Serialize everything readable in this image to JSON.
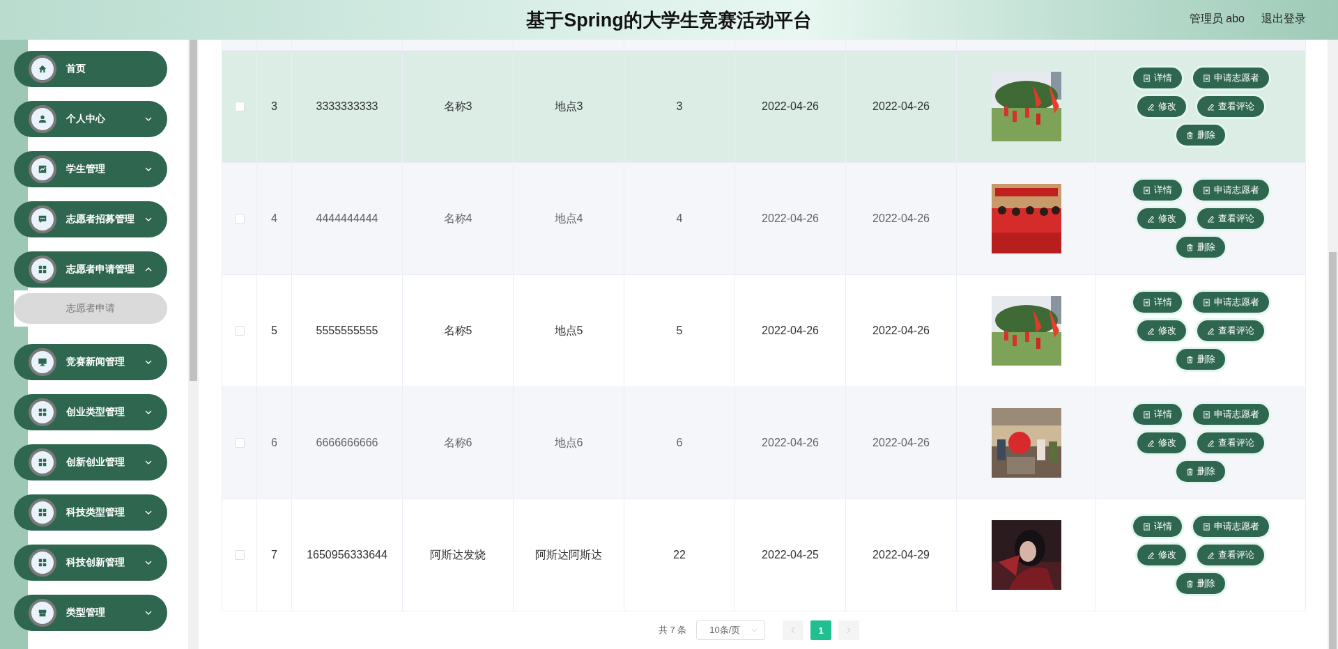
{
  "header": {
    "title": "基于Spring的大学生竞赛活动平台",
    "user": "管理员 abo",
    "logout": "退出登录"
  },
  "sidebar": {
    "items": [
      {
        "label": "首页",
        "kind": "link"
      },
      {
        "label": "个人中心",
        "kind": "menu",
        "expanded": false
      },
      {
        "label": "学生管理",
        "kind": "menu",
        "expanded": false
      },
      {
        "label": "志愿者招募管理",
        "kind": "menu",
        "expanded": false
      },
      {
        "label": "志愿者申请管理",
        "kind": "menu",
        "expanded": true,
        "children": [
          {
            "label": "志愿者申请",
            "selected": false
          }
        ]
      },
      {
        "label": "竞赛新闻管理",
        "kind": "menu",
        "expanded": false
      },
      {
        "label": "创业类型管理",
        "kind": "menu",
        "expanded": false
      },
      {
        "label": "创新创业管理",
        "kind": "menu",
        "expanded": false
      },
      {
        "label": "科技类型管理",
        "kind": "menu",
        "expanded": false
      },
      {
        "label": "科技创新管理",
        "kind": "menu",
        "expanded": false
      },
      {
        "label": "类型管理",
        "kind": "menu",
        "expanded": false
      }
    ]
  },
  "table": {
    "rows": [
      {
        "checked": false,
        "highlighted": true,
        "index": "3",
        "cells": [
          "3333333333",
          "名称3",
          "地点3",
          "3",
          "2022-04-26",
          "2022-04-26"
        ],
        "actions": [
          {
            "label": "详情",
            "kind": "document"
          },
          {
            "label": "申请志愿者",
            "kind": "document"
          },
          {
            "label": "修改",
            "kind": "edit"
          },
          {
            "label": "查看评论",
            "kind": "edit"
          },
          {
            "label": "删除",
            "kind": "delete"
          }
        ]
      },
      {
        "checked": false,
        "highlighted": false,
        "index": "4",
        "cells": [
          "4444444444",
          "名称4",
          "地点4",
          "4",
          "2022-04-26",
          "2022-04-26"
        ],
        "actions": [
          {
            "label": "详情",
            "kind": "document"
          },
          {
            "label": "申请志愿者",
            "kind": "document"
          },
          {
            "label": "修改",
            "kind": "edit"
          },
          {
            "label": "查看评论",
            "kind": "edit"
          },
          {
            "label": "删除",
            "kind": "delete"
          }
        ]
      },
      {
        "checked": false,
        "highlighted": false,
        "index": "5",
        "cells": [
          "5555555555",
          "名称5",
          "地点5",
          "5",
          "2022-04-26",
          "2022-04-26"
        ],
        "actions": [
          {
            "label": "详情",
            "kind": "document"
          },
          {
            "label": "申请志愿者",
            "kind": "document"
          },
          {
            "label": "修改",
            "kind": "edit"
          },
          {
            "label": "查看评论",
            "kind": "edit"
          },
          {
            "label": "删除",
            "kind": "delete"
          }
        ]
      },
      {
        "checked": false,
        "highlighted": false,
        "index": "6",
        "cells": [
          "6666666666",
          "名称6",
          "地点6",
          "6",
          "2022-04-26",
          "2022-04-26"
        ],
        "actions": [
          {
            "label": "详情",
            "kind": "document"
          },
          {
            "label": "申请志愿者",
            "kind": "document"
          },
          {
            "label": "修改",
            "kind": "edit"
          },
          {
            "label": "查看评论",
            "kind": "edit"
          },
          {
            "label": "删除",
            "kind": "delete"
          }
        ]
      },
      {
        "checked": false,
        "highlighted": false,
        "index": "7",
        "cells": [
          "1650956333644",
          "阿斯达发烧",
          "阿斯达阿斯达",
          "22",
          "2022-04-25",
          "2022-04-29"
        ],
        "actions": [
          {
            "label": "详情",
            "kind": "document"
          },
          {
            "label": "申请志愿者",
            "kind": "document"
          },
          {
            "label": "修改",
            "kind": "edit"
          },
          {
            "label": "查看评论",
            "kind": "edit"
          },
          {
            "label": "删除",
            "kind": "delete"
          }
        ]
      }
    ]
  },
  "pagination": {
    "total": "共 7 条",
    "page_size": "10条/页",
    "pages": [
      {
        "label": "1",
        "selected": true
      }
    ]
  }
}
